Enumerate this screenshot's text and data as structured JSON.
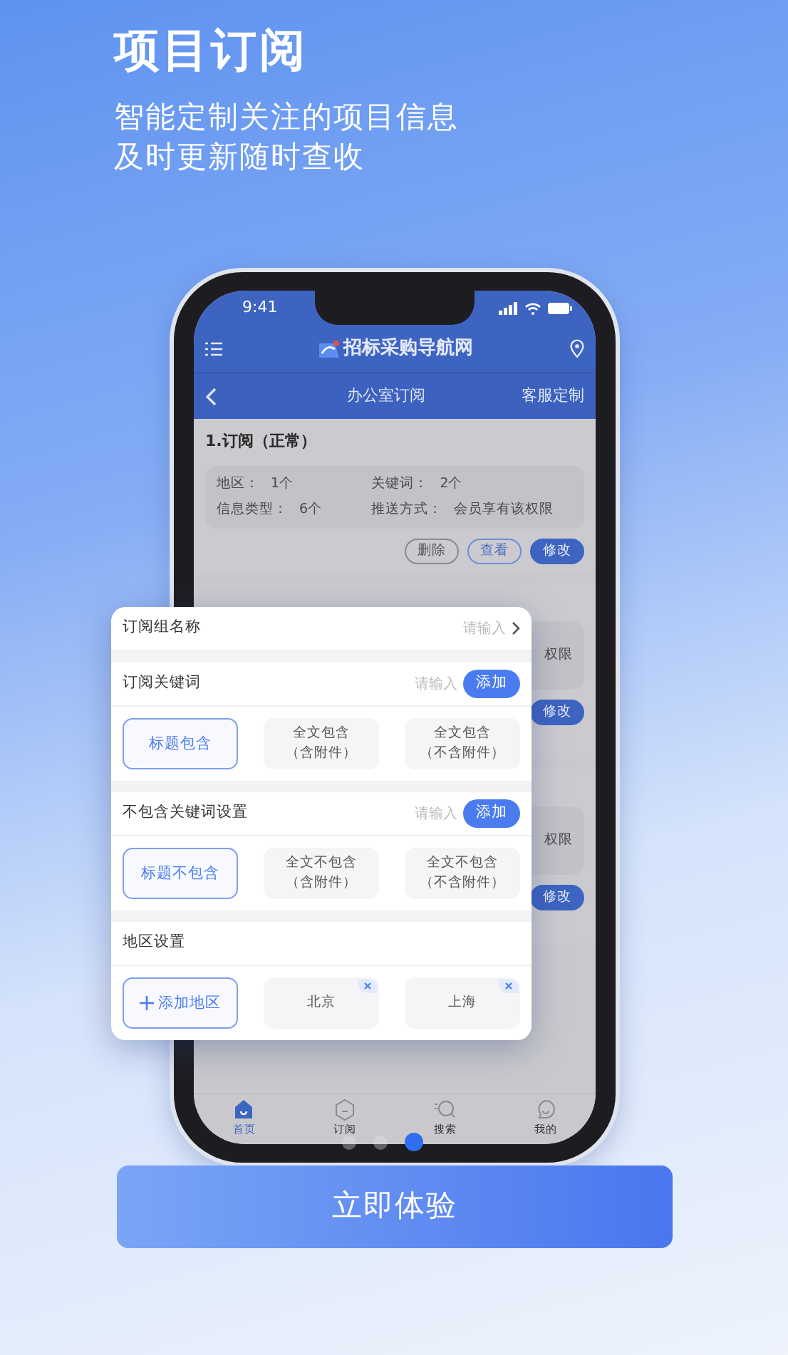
{
  "header": {
    "title": "项目订阅",
    "subtitle_lines": [
      "智能定制关注的项目信息",
      "及时更新随时查收"
    ]
  },
  "phone": {
    "status_bar": {
      "time": "9:41"
    },
    "app_bar": {
      "logo_text": "招标采购导航网"
    },
    "nav": {
      "title": "办公室订阅",
      "action": "客服定制"
    },
    "subscriptions": [
      {
        "title": "1.订阅（正常）",
        "fields": [
          {
            "label": "地区：",
            "value": "1个"
          },
          {
            "label": "关键词：",
            "value": "2个"
          },
          {
            "label": "信息类型：",
            "value": "6个"
          },
          {
            "label": "推送方式：",
            "value": "会员享有该权限"
          }
        ],
        "buttons": [
          {
            "label": "删除",
            "kind": "plain"
          },
          {
            "label": "查看",
            "kind": "outline"
          },
          {
            "label": "修改",
            "kind": "primary"
          }
        ]
      }
    ],
    "covered_cards": [
      {
        "text": "权限",
        "button": "修改"
      },
      {
        "text": "权限",
        "button": "修改"
      }
    ],
    "tab_bar": [
      {
        "label": "首页",
        "selected": true
      },
      {
        "label": "订阅",
        "selected": false
      },
      {
        "label": "搜索",
        "selected": false
      },
      {
        "label": "我的",
        "selected": false
      }
    ]
  },
  "popup": {
    "sections": [
      {
        "kind": "input",
        "label": "订阅组名称",
        "placeholder": "请输入"
      },
      {
        "kind": "keywords",
        "label": "订阅关键词",
        "placeholder": "请输入",
        "add_button": "添加",
        "options": [
          {
            "lines": [
              "标题包含"
            ],
            "selected": true
          },
          {
            "lines": [
              "全文包含",
              "（含附件）"
            ],
            "selected": false
          },
          {
            "lines": [
              "全文包含",
              "（不含附件）"
            ],
            "selected": false
          }
        ]
      },
      {
        "kind": "keywords",
        "label": "不包含关键词设置",
        "placeholder": "请输入",
        "add_button": "添加",
        "options": [
          {
            "lines": [
              "标题不包含"
            ],
            "selected": true
          },
          {
            "lines": [
              "全文不包含",
              "（含附件）"
            ],
            "selected": false
          },
          {
            "lines": [
              "全文不包含",
              "（不含附件）"
            ],
            "selected": false
          }
        ]
      },
      {
        "kind": "regions",
        "label": "地区设置",
        "add_label": "添加地区",
        "regions": [
          "北京",
          "上海"
        ]
      }
    ]
  },
  "carousel": [
    {
      "selected": false
    },
    {
      "selected": false
    },
    {
      "selected": true
    }
  ],
  "cta": "立即体验"
}
